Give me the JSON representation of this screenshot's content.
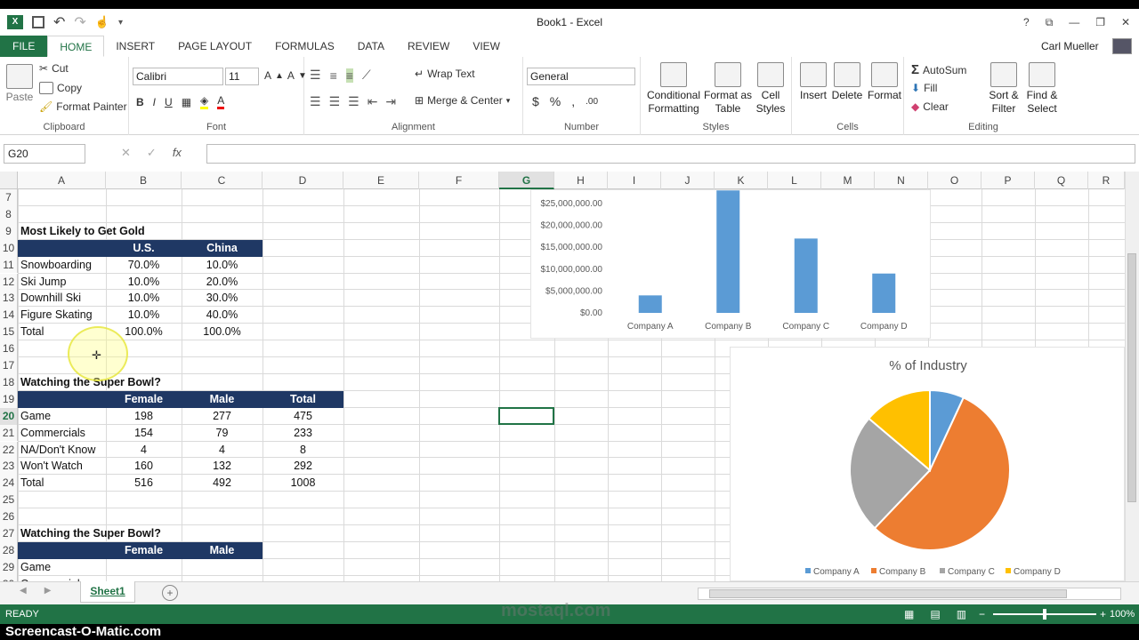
{
  "window": {
    "title": "Book1 - Excel",
    "user": "Carl Mueller",
    "help": "?"
  },
  "ribbon_tabs": [
    "FILE",
    "HOME",
    "INSERT",
    "PAGE LAYOUT",
    "FORMULAS",
    "DATA",
    "REVIEW",
    "VIEW"
  ],
  "clipboard": {
    "paste": "Paste",
    "cut": "Cut",
    "copy": "Copy",
    "format_painter": "Format Painter",
    "label": "Clipboard"
  },
  "font": {
    "name": "Calibri",
    "size": "11",
    "label": "Font",
    "bold": "B",
    "italic": "I",
    "underline": "U"
  },
  "alignment": {
    "wrap": "Wrap Text",
    "merge": "Merge & Center",
    "label": "Alignment"
  },
  "number": {
    "format": "General",
    "currency": "$",
    "percent": "%",
    "comma": ",",
    "label": "Number"
  },
  "styles": {
    "conditional": "Conditional",
    "conditional2": "Formatting",
    "format_as": "Format as",
    "format_as2": "Table",
    "cell_styles": "Cell",
    "cell_styles2": "Styles",
    "label": "Styles"
  },
  "cells": {
    "insert": "Insert",
    "delete": "Delete",
    "format": "Format",
    "label": "Cells"
  },
  "editing": {
    "autosum": "AutoSum",
    "fill": "Fill",
    "clear": "Clear",
    "sort": "Sort &",
    "sort2": "Filter",
    "find": "Find &",
    "find2": "Select",
    "label": "Editing"
  },
  "formula": {
    "namebox": "G20",
    "fx": "fx",
    "value": ""
  },
  "columns": [
    "A",
    "B",
    "C",
    "D",
    "E",
    "F",
    "G",
    "H",
    "I",
    "J",
    "K",
    "L",
    "M",
    "N",
    "O",
    "P",
    "Q",
    "R"
  ],
  "rows": [
    "7",
    "8",
    "9",
    "10",
    "11",
    "12",
    "13",
    "14",
    "15",
    "16",
    "17",
    "18",
    "19",
    "20",
    "21",
    "22",
    "23",
    "24",
    "25",
    "26",
    "27",
    "28",
    "29",
    "30"
  ],
  "table1": {
    "title": "Most Likely to Get Gold",
    "headers": [
      "U.S.",
      "China"
    ],
    "rows": [
      [
        "Snowboarding",
        "70.0%",
        "10.0%"
      ],
      [
        "Ski Jump",
        "10.0%",
        "20.0%"
      ],
      [
        "Downhill Ski",
        "10.0%",
        "30.0%"
      ],
      [
        "Figure Skating",
        "10.0%",
        "40.0%"
      ],
      [
        "Total",
        "100.0%",
        "100.0%"
      ]
    ]
  },
  "table2": {
    "title": "Watching the Super Bowl?",
    "headers": [
      "Female",
      "Male",
      "Total"
    ],
    "rows": [
      [
        "Game",
        "198",
        "277",
        "475"
      ],
      [
        "Commercials",
        "154",
        "79",
        "233"
      ],
      [
        "NA/Don't Know",
        "4",
        "4",
        "8"
      ],
      [
        "Won't Watch",
        "160",
        "132",
        "292"
      ],
      [
        "Total",
        "516",
        "492",
        "1008"
      ]
    ]
  },
  "table3": {
    "title": "Watching the Super Bowl?",
    "headers": [
      "Female",
      "Male"
    ],
    "rows": [
      [
        "Game"
      ],
      [
        "Commercials"
      ]
    ]
  },
  "chart_data": [
    {
      "type": "bar",
      "title": "",
      "categories": [
        "Company A",
        "Company B",
        "Company C",
        "Company D"
      ],
      "values": [
        4000000,
        28000000,
        17000000,
        9000000
      ],
      "yticks": [
        "$0.00",
        "$5,000,000.00",
        "$10,000,000.00",
        "$15,000,000.00",
        "$20,000,000.00",
        "$25,000,000.00"
      ],
      "ylim": [
        0,
        25000000
      ],
      "color": "#5b9bd5"
    },
    {
      "type": "pie",
      "title": "% of Industry",
      "categories": [
        "Company A",
        "Company B",
        "Company C",
        "Company D"
      ],
      "values": [
        6.9,
        55.2,
        24.1,
        13.8
      ],
      "colors": [
        "#5b9bd5",
        "#ed7d31",
        "#a5a5a5",
        "#ffc000"
      ],
      "legend": "bottom"
    }
  ],
  "sheet": {
    "name": "Sheet1"
  },
  "status": {
    "ready": "READY",
    "zoom": "100%"
  },
  "watermark": {
    "brand": "mostaql.com",
    "recorder": "Screencast-O-Matic.com"
  }
}
